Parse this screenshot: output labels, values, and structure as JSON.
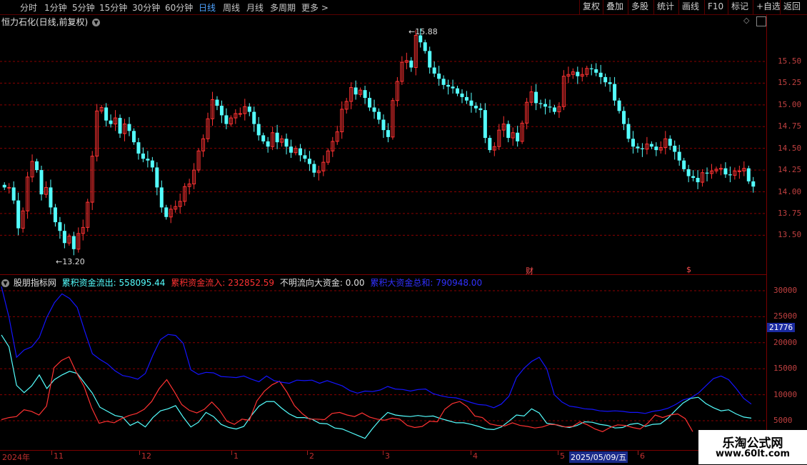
{
  "toolbar": {
    "tabs": [
      "分时",
      "1分钟",
      "5分钟",
      "15分钟",
      "30分钟",
      "60分钟",
      "日线",
      "周线",
      "月线",
      "多周期",
      "更多 >"
    ],
    "active_tab": "日线",
    "right_buttons": [
      "复权",
      "叠加",
      "多股",
      "统计",
      "画线",
      "F10",
      "标记",
      "+自选",
      "返回"
    ]
  },
  "main_panel": {
    "title": "恒力石化(日线,前复权)",
    "high_label": "15.88",
    "low_label": "13.20",
    "event_cai": "财",
    "event_s": "$",
    "y_ticks": [
      "15.50",
      "15.25",
      "15.00",
      "14.75",
      "14.50",
      "14.25",
      "14.00",
      "13.75",
      "13.50"
    ]
  },
  "indicator_panel": {
    "name": "股朋指标网",
    "outflow_label": "累积资金流出:",
    "outflow_value": "558095.44",
    "inflow_label": "累积资金流入:",
    "inflow_value": "232852.59",
    "unknown_label": "不明流向大资金:",
    "unknown_value": "0.00",
    "total_label": "累积大资金总和:",
    "total_value": "790948.00",
    "y_ticks": [
      "30000",
      "25000",
      "20000",
      "15000",
      "10000",
      "5000"
    ],
    "current_value": "21776"
  },
  "date_axis": {
    "labels": [
      "2024年",
      "11",
      "12",
      "1",
      "2",
      "3",
      "4",
      "5",
      "6"
    ],
    "current_date": "2025/05/09/五"
  },
  "watermark": {
    "line1": "乐淘公式网",
    "line2": "www.60lt.com"
  },
  "colors": {
    "up": "#ff3232",
    "down": "#54ffff",
    "total": "#1414ff",
    "grid": "#8a0000"
  },
  "chart_data": [
    {
      "type": "candlestick",
      "title": "恒力石化(日线,前复权)",
      "ylim": [
        13.25,
        15.85
      ],
      "y_ticks": [
        13.5,
        13.75,
        14.0,
        14.25,
        14.5,
        14.75,
        15.0,
        15.25,
        15.5
      ],
      "annotations": [
        {
          "label": "15.88",
          "kind": "high"
        },
        {
          "label": "13.20",
          "kind": "low"
        }
      ],
      "closes": [
        14.05,
        14.05,
        13.9,
        13.58,
        13.78,
        14.17,
        14.35,
        14.25,
        13.97,
        14.05,
        13.82,
        13.65,
        13.55,
        13.41,
        13.49,
        13.34,
        13.52,
        13.59,
        13.88,
        14.41,
        14.93,
        14.97,
        14.82,
        14.78,
        14.85,
        14.67,
        14.78,
        14.7,
        14.57,
        14.44,
        14.38,
        14.36,
        14.28,
        14.05,
        13.82,
        13.71,
        13.8,
        13.83,
        13.89,
        14.06,
        14.09,
        14.25,
        14.47,
        14.61,
        14.84,
        15.06,
        14.99,
        14.88,
        14.78,
        14.85,
        14.9,
        14.9,
        14.98,
        14.92,
        14.78,
        14.65,
        14.58,
        14.52,
        14.68,
        14.57,
        14.61,
        14.52,
        14.45,
        14.5,
        14.42,
        14.38,
        14.32,
        14.22,
        14.24,
        14.34,
        14.47,
        14.58,
        14.69,
        14.95,
        15.04,
        15.2,
        15.12,
        15.17,
        15.08,
        14.97,
        14.92,
        14.83,
        14.71,
        14.63,
        15.05,
        15.27,
        15.49,
        15.51,
        15.43,
        15.8,
        15.72,
        15.62,
        15.43,
        15.36,
        15.3,
        15.23,
        15.21,
        15.19,
        15.13,
        15.09,
        15.05,
        14.99,
        14.96,
        14.94,
        14.62,
        14.48,
        14.52,
        14.71,
        14.78,
        14.62,
        14.68,
        14.58,
        14.79,
        15.03,
        15.15,
        15.02,
        15.01,
        14.98,
        14.97,
        14.92,
        14.98,
        15.33,
        15.35,
        15.38,
        15.33,
        15.35,
        15.42,
        15.41,
        15.37,
        15.32,
        15.26,
        15.24,
        15.05,
        14.93,
        14.78,
        14.61,
        14.52,
        14.5,
        14.49,
        14.55,
        14.52,
        14.48,
        14.51,
        14.61,
        14.53,
        14.46,
        14.36,
        14.26,
        14.18,
        14.16,
        14.11,
        14.22,
        14.21,
        14.24,
        14.26,
        14.27,
        14.2,
        14.19,
        14.24,
        14.24,
        14.27,
        14.12,
        14.06
      ]
    },
    {
      "type": "line",
      "ylim": [
        0,
        31000
      ],
      "y_ticks": [
        5000,
        10000,
        15000,
        20000,
        25000,
        30000
      ],
      "series": [
        {
          "name": "累积资金流出",
          "values": [
            21500,
            19200,
            11800,
            10400,
            11700,
            13800,
            11200,
            12900,
            13800,
            14500,
            14100,
            12200,
            10300,
            7600,
            6800,
            6000,
            5700,
            4100,
            4800,
            3800,
            5600,
            6900,
            7300,
            7900,
            5700,
            3800,
            4700,
            6600,
            5800,
            4300,
            3700,
            3400,
            3900,
            6000,
            7800,
            8700,
            8700,
            7400,
            6300,
            5600,
            5600,
            5300,
            4500,
            4400,
            3600,
            3400,
            2800,
            2200,
            1600,
            3500,
            5200,
            6600,
            6100,
            5900,
            5800,
            6000,
            5800,
            5900,
            5400,
            5000,
            4600,
            4600,
            4300,
            3900,
            3400,
            3300,
            3800,
            4900,
            6100,
            5900,
            7300,
            6500,
            4500,
            4300,
            3900,
            3700,
            4100,
            4800,
            4700,
            4300,
            4100,
            3600,
            3700,
            4300,
            4500,
            3900,
            4300,
            4400,
            5500,
            7000,
            8400,
            9300,
            9500,
            8300,
            7500,
            6900,
            7100,
            6300,
            5700,
            5500
          ]
        },
        {
          "name": "累积资金流入",
          "values": [
            5200,
            5600,
            5800,
            7100,
            6800,
            6100,
            7800,
            15200,
            16600,
            17300,
            14200,
            11600,
            7500,
            4500,
            4900,
            4600,
            5400,
            6000,
            6400,
            7200,
            8700,
            11200,
            12900,
            10600,
            8100,
            7000,
            6500,
            7200,
            8600,
            7100,
            4900,
            4300,
            5300,
            5100,
            8800,
            10700,
            11900,
            12600,
            10500,
            7900,
            6400,
            5300,
            5300,
            5200,
            6400,
            6600,
            6100,
            5800,
            6500,
            5700,
            5300,
            5100,
            5500,
            5300,
            4100,
            3700,
            3900,
            4900,
            4800,
            7200,
            8300,
            8700,
            7700,
            5900,
            5600,
            4400,
            4100,
            4000,
            4600,
            4100,
            3900,
            3600,
            3800,
            4300,
            4200,
            3800,
            3900,
            4800,
            4200,
            3400,
            2900,
            3700,
            4200,
            4100,
            3700,
            3400,
            4500,
            6100,
            5600,
            6100,
            6300,
            5400,
            2900
          ]
        },
        {
          "name": "累积大资金总和",
          "values": [
            30800,
            24900,
            17200,
            18600,
            19200,
            21000,
            24900,
            27700,
            29400,
            28500,
            26800,
            22200,
            17900,
            16800,
            15900,
            14600,
            13700,
            13400,
            13000,
            14100,
            17600,
            20600,
            21600,
            21400,
            19900,
            14800,
            13900,
            14300,
            14200,
            13500,
            13400,
            13300,
            13600,
            13000,
            12500,
            13600,
            12700,
            12400,
            12200,
            12800,
            12700,
            12800,
            12200,
            12700,
            12200,
            11700,
            10800,
            10300,
            10700,
            10600,
            10900,
            11600,
            11100,
            11000,
            10700,
            11000,
            11100,
            10200,
            9800,
            9500,
            9400,
            9000,
            8500,
            8100,
            8000,
            7500,
            8200,
            9700,
            13300,
            15100,
            16400,
            17200,
            15000,
            10000,
            8600,
            7800,
            7600,
            7300,
            7200,
            6900,
            6800,
            6900,
            6800,
            6600,
            6600,
            6400,
            6800,
            7000,
            7400,
            8100,
            9000,
            9400,
            10300,
            11700,
            13100,
            13600,
            12900,
            11200,
            9300,
            8200
          ]
        }
      ]
    }
  ]
}
